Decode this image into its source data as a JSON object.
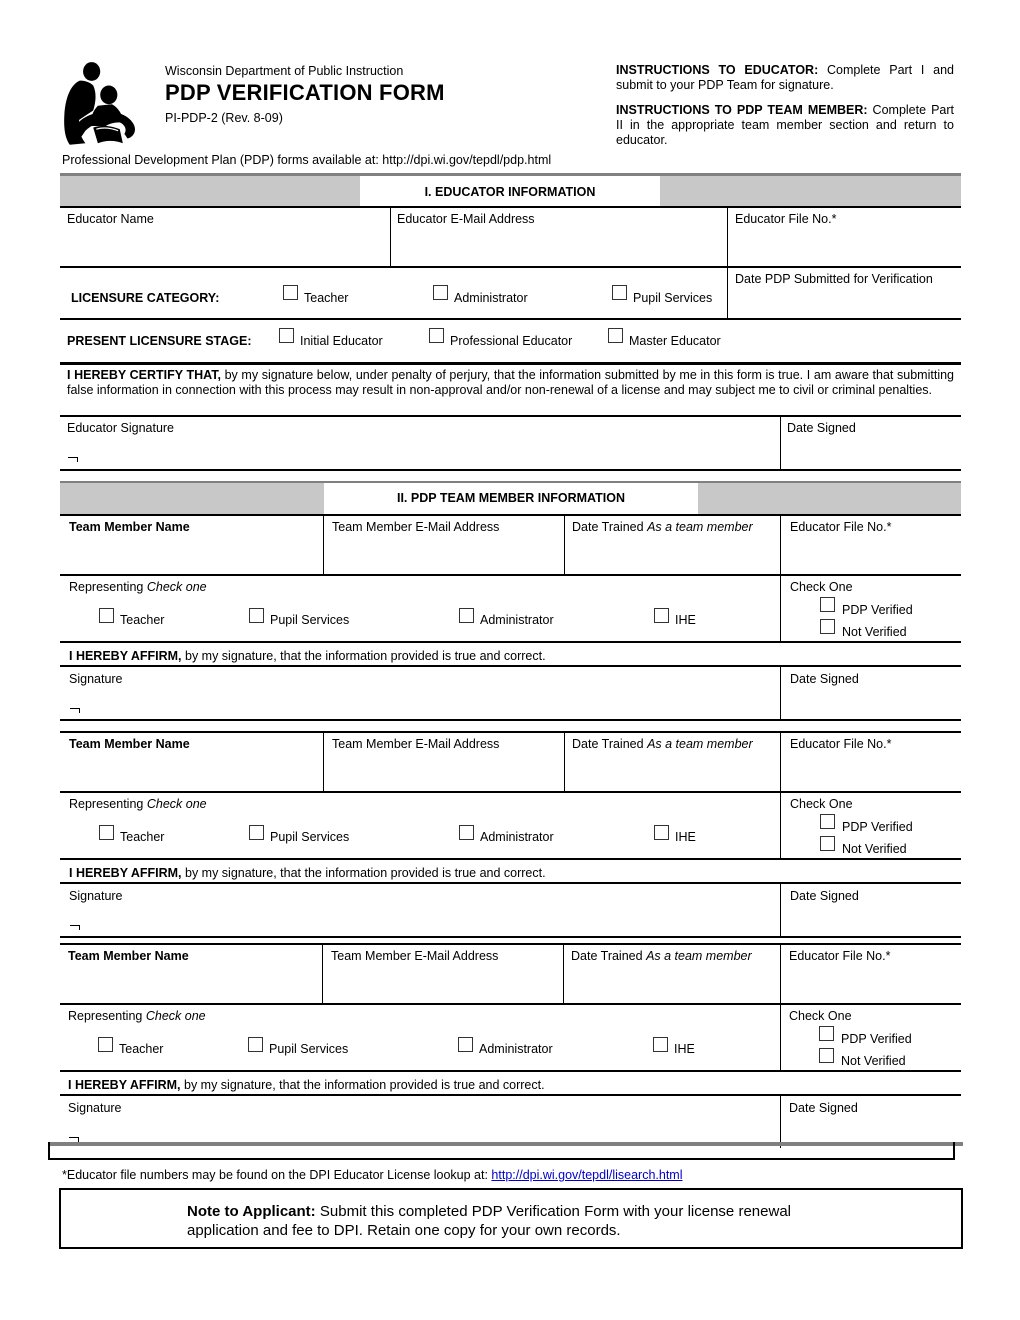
{
  "header": {
    "agency": "Wisconsin Department of Public Instruction",
    "title": "PDP VERIFICATION FORM",
    "form_number": "PI-PDP-2 (Rev. 8-09)",
    "logo_icon": "adult-reading-with-child-logo",
    "instructions_educator_label": "INSTRUCTIONS TO EDUCATOR:",
    "instructions_educator_text": " Complete Part I and submit to your PDP Team for signature.",
    "instructions_team_label": "INSTRUCTIONS TO PDP TEAM MEMBER:",
    "instructions_team_text": " Complete Part II in the appropriate team member section and return to educator.",
    "forms_available": "Professional Development Plan (PDP) forms available at:  http://dpi.wi.gov/tepdl/pdp.html"
  },
  "part1": {
    "title": "I. EDUCATOR INFORMATION",
    "educator_name": "Educator Name",
    "educator_email": "Educator E-Mail Address",
    "educator_file_no": "Educator File No.*",
    "date_submitted": "Date PDP Submitted for Verification",
    "licensure_category_label": "LICENSURE CATEGORY:",
    "licensure_category_options": [
      "Teacher",
      "Administrator",
      "Pupil Services"
    ],
    "licensure_stage_label": "PRESENT LICENSURE STAGE:",
    "licensure_stage_options": [
      "Initial Educator",
      "Professional Educator",
      "Master Educator"
    ],
    "certify_bold": "I HEREBY CERTIFY THAT,",
    "certify_text": " by my signature below, under penalty of perjury, that the information submitted by me in this form is true. I am aware that submitting false information in connection with this process may result in non-approval and/or non-renewal of a license and may subject me to civil or criminal penalties.",
    "signature_label": "Educator Signature",
    "date_signed_label": "Date Signed"
  },
  "part2": {
    "title": "II. PDP TEAM MEMBER INFORMATION",
    "members": [
      {
        "name_label": "Team Member Name",
        "email_label": "Team Member E-Mail Address",
        "date_trained_label": "Date Trained",
        "date_trained_hint": "As a team member",
        "file_no_label": "Educator File No.*",
        "representing_label": "Representing",
        "representing_hint": "Check one",
        "representing_options": [
          "Teacher",
          "Pupil Services",
          "Administrator",
          "IHE"
        ],
        "check_one_label": "Check One",
        "verification_options": [
          "PDP Verified",
          "Not Verified"
        ],
        "affirm_bold": "I HEREBY AFFIRM,",
        "affirm_text": " by my signature, that the information provided is true and correct.",
        "signature_label": "Signature",
        "date_signed_label": "Date Signed"
      },
      {
        "name_label": "Team Member Name",
        "email_label": "Team Member E-Mail Address",
        "date_trained_label": "Date Trained",
        "date_trained_hint": "As a team member",
        "file_no_label": "Educator File No.*",
        "representing_label": "Representing",
        "representing_hint": "Check one",
        "representing_options": [
          "Teacher",
          "Pupil Services",
          "Administrator",
          "IHE"
        ],
        "check_one_label": "Check One",
        "verification_options": [
          "PDP Verified",
          "Not Verified"
        ],
        "affirm_bold": "I HEREBY AFFIRM,",
        "affirm_text": " by my signature, that the information provided is true and correct.",
        "signature_label": "Signature",
        "date_signed_label": "Date Signed"
      },
      {
        "name_label": "Team Member Name",
        "email_label": "Team Member E-Mail Address",
        "date_trained_label": "Date Trained",
        "date_trained_hint": "As a team member",
        "file_no_label": "Educator File No.*",
        "representing_label": "Representing",
        "representing_hint": "Check one",
        "representing_options": [
          "Teacher",
          "Pupil Services",
          "Administrator",
          "IHE"
        ],
        "check_one_label": "Check One",
        "verification_options": [
          "PDP Verified",
          "Not Verified"
        ],
        "affirm_bold": "I HEREBY AFFIRM,",
        "affirm_text": " by my signature, that the information provided is true and correct.",
        "signature_label": "Signature",
        "date_signed_label": "Date Signed"
      }
    ]
  },
  "footer": {
    "footnote_text": "*Educator file numbers may be found on the DPI Educator License lookup at: ",
    "footnote_link": "http://dpi.wi.gov/tepdl/lisearch.html",
    "note_bold": "Note to Applicant:",
    "note_text": " Submit this completed PDP Verification Form with your license renewal application and fee to DPI. Retain one copy for your own records."
  },
  "colors": {
    "section_header_grey": "#c8c8c8",
    "rule_grey": "#808080",
    "link_blue": "#0000cc"
  }
}
